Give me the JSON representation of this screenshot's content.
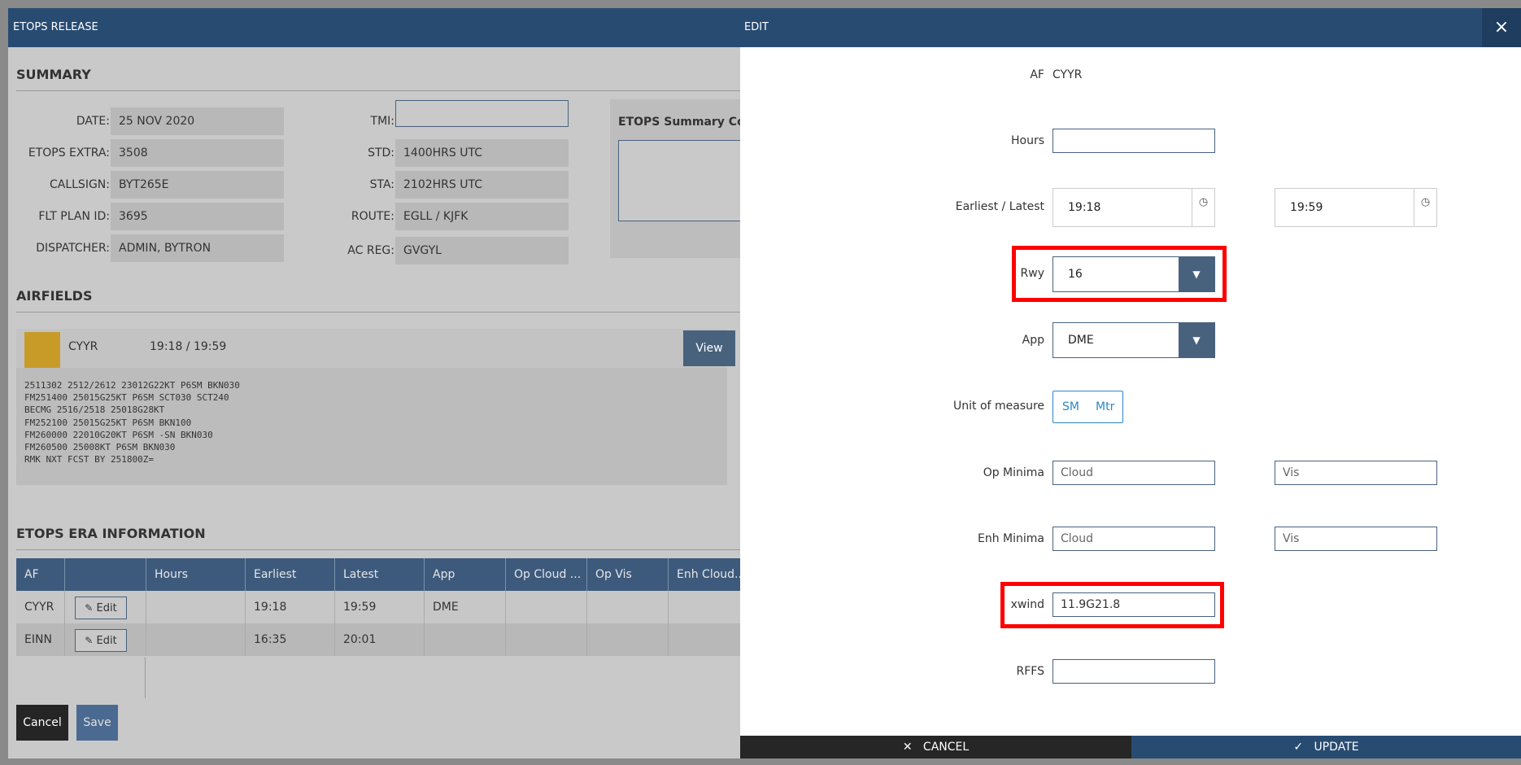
{
  "etops_window": {
    "title": "ETOPS RELEASE",
    "summary": {
      "heading": "SUMMARY",
      "left_fields": [
        {
          "label": "DATE:",
          "value": "25 NOV 2020"
        },
        {
          "label": "ETOPS EXTRA:",
          "value": "3508"
        },
        {
          "label": "CALLSIGN:",
          "value": "BYT265E"
        },
        {
          "label": "FLT PLAN ID:",
          "value": "3695"
        },
        {
          "label": "DISPATCHER:",
          "value": "ADMIN, BYTRON"
        }
      ],
      "right_fields": [
        {
          "label": "TMI:",
          "value": ""
        },
        {
          "label": "STD:",
          "value": "1400HRS UTC"
        },
        {
          "label": "STA:",
          "value": "2102HRS UTC"
        },
        {
          "label": "ROUTE:",
          "value": "EGLL / KJFK"
        },
        {
          "label": "AC REG:",
          "value": "GVGYL"
        }
      ],
      "comments_label": "ETOPS Summary Comm"
    },
    "airfields": {
      "heading": "AIRFIELDS",
      "item": {
        "code": "CYYR",
        "times": "19:18 / 19:59",
        "view_label": "View",
        "swatch_color": "#c89b29",
        "taf": "2511302 2512/2612 23012G22KT P6SM BKN030\nFM251400 25015G25KT P6SM SCT030 SCT240\nBECMG 2516/2518 25018G28KT\nFM252100 25015G25KT P6SM BKN100\nFM260000 22010G20KT P6SM -SN BKN030\nFM260500 25008KT P6SM BKN030\nRMK NXT FCST BY 251800Z="
      }
    },
    "era": {
      "heading": "ETOPS ERA INFORMATION",
      "columns": [
        "AF",
        "",
        "Hours",
        "Earliest",
        "Latest",
        "App",
        "Op Cloud ...",
        "Op Vis",
        "Enh Cloud..."
      ],
      "edit_label": "Edit",
      "rows": [
        {
          "af": "CYYR",
          "hours": "",
          "earliest": "19:18",
          "latest": "19:59",
          "app": "DME",
          "op_cloud": "",
          "op_vis": "",
          "enh_cloud": ""
        },
        {
          "af": "EINN",
          "hours": "",
          "earliest": "16:35",
          "latest": "20:01",
          "app": "",
          "op_cloud": "",
          "op_vis": "",
          "enh_cloud": ""
        }
      ]
    },
    "buttons": {
      "cancel": "Cancel",
      "save": "Save"
    }
  },
  "edit_panel": {
    "title": "EDIT",
    "close_icon": "×",
    "af": {
      "label": "AF",
      "value": "CYYR"
    },
    "hours": {
      "label": "Hours",
      "value": ""
    },
    "earliest_latest": {
      "label": "Earliest / Latest",
      "earliest": "19:18",
      "latest": "19:59"
    },
    "rwy": {
      "label": "Rwy",
      "value": "16"
    },
    "app": {
      "label": "App",
      "value": "DME"
    },
    "unit": {
      "label": "Unit of measure",
      "options": [
        "SM",
        "Mtr"
      ]
    },
    "op_minima": {
      "label": "Op Minima",
      "cloud_placeholder": "Cloud",
      "vis_placeholder": "Vis"
    },
    "enh_minima": {
      "label": "Enh Minima",
      "cloud_placeholder": "Cloud",
      "vis_placeholder": "Vis"
    },
    "xwind": {
      "label": "xwind",
      "value": "11.9G21.8"
    },
    "rffs": {
      "label": "RFFS",
      "value": ""
    },
    "footer": {
      "cancel": "CANCEL",
      "update": "UPDATE"
    },
    "highlight_color": "#ff0000"
  }
}
